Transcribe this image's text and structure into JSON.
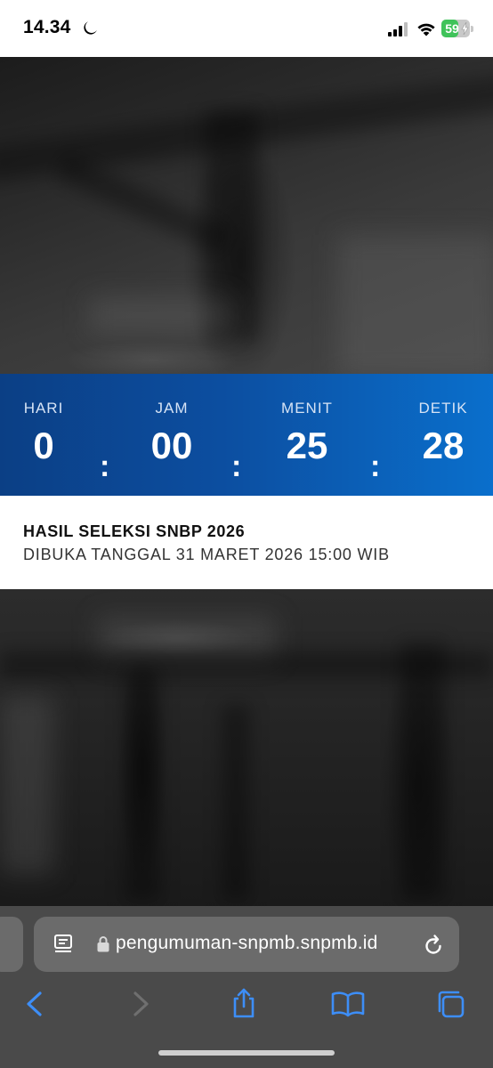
{
  "status_bar": {
    "time": "14.34",
    "battery_level": "59",
    "battery_fraction": 0.59,
    "battery_color": "#3fc35a"
  },
  "countdown": {
    "background_start": "#0b3f85",
    "background_end": "#0a6fcc",
    "units": [
      {
        "label": "HARI",
        "value": "0"
      },
      {
        "label": "JAM",
        "value": "00"
      },
      {
        "label": "MENIT",
        "value": "25"
      },
      {
        "label": "DETIK",
        "value": "28"
      }
    ],
    "separator": ":"
  },
  "announcement": {
    "title": "HASIL SELEKSI SNBP 2026",
    "subtitle": "DIBUKA TANGGAL 31 MARET 2026 15:00 WIB"
  },
  "browser": {
    "url": "pengumuman-snpmb.snpmb.id",
    "accent": "#3d8ef7",
    "icons": {
      "reader": "reader-mode-icon",
      "lock": "lock-icon",
      "reload": "reload-icon",
      "back": "back-chevron-icon",
      "forward": "forward-chevron-icon",
      "share": "share-icon",
      "bookmarks": "bookmarks-book-icon",
      "tabs": "tabs-icon"
    }
  }
}
